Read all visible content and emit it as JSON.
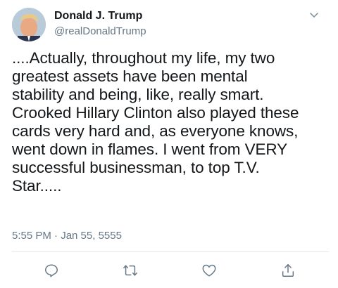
{
  "author": {
    "display_name": "Donald J. Trump",
    "handle": "@realDonaldTrump"
  },
  "tweet": {
    "text": "....Actually, throughout my life, my two\ngreatest assets have been mental\nstability and being, like, really smart.\nCrooked Hillary Clinton also played these\ncards very hard and, as everyone knows,\nwent down in flames. I went from VERY\nsuccessful businessman, to top T.V.\nStar.....",
    "timestamp": "5:55 PM · Jan 55, 5555"
  },
  "icons": {
    "menu": "chevron-down-icon",
    "reply": "reply-icon",
    "retweet": "retweet-icon",
    "like": "heart-icon",
    "share": "share-icon"
  },
  "colors": {
    "text": "#14171a",
    "secondary": "#657786",
    "divider": "#e1e8ed"
  }
}
